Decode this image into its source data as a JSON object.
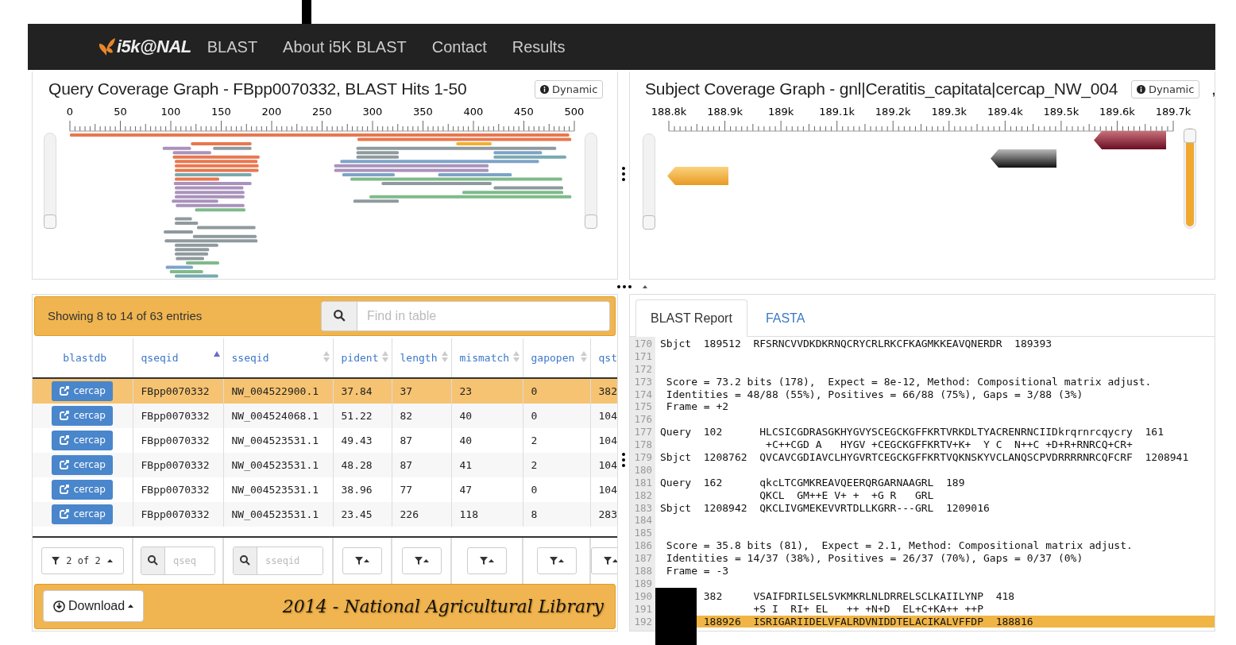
{
  "navbar": {
    "logo": "i5k@NAL",
    "links": [
      {
        "label": "BLAST"
      },
      {
        "label": "About i5K BLAST"
      },
      {
        "label": "Contact"
      },
      {
        "label": "Results"
      }
    ]
  },
  "query_graph": {
    "title": "Query Coverage Graph - FBpp0070332, BLAST Hits 1-50",
    "mode_button": "Dynamic",
    "axis_labels": [
      "0",
      "50",
      "100",
      "150",
      "200",
      "250",
      "300",
      "350",
      "400",
      "450",
      "500"
    ],
    "sliders": [
      {
        "level": 0
      },
      {
        "level": 0
      }
    ]
  },
  "subject_graph": {
    "title": "Subject Coverage Graph - gnl|Ceratitis_capitata|cercap_NW_004",
    "mode_button": "Dynamic",
    "title_tail": ",",
    "axis_labels": [
      "188.8k",
      "188.9k",
      "189k",
      "189.1k",
      "189.2k",
      "189.3k",
      "189.4k",
      "189.5k",
      "189.6k",
      "189.7k"
    ],
    "sliders": [
      {
        "level": 0
      },
      {
        "level": 1
      }
    ]
  },
  "table": {
    "info": "Showing 8 to 14 of 63 entries",
    "search": {
      "placeholder": "Find in table"
    },
    "columns": [
      {
        "label": "blastdb",
        "sortable": false,
        "sorted_ascending": false
      },
      {
        "label": "qseqid",
        "sortable": true,
        "sorted_ascending": true
      },
      {
        "label": "sseqid",
        "sortable": true,
        "sorted_ascending": false
      },
      {
        "label": "pident",
        "sortable": true,
        "sorted_ascending": false
      },
      {
        "label": "length",
        "sortable": true,
        "sorted_ascending": false
      },
      {
        "label": "mismatch",
        "sortable": true,
        "sorted_ascending": false
      },
      {
        "label": "gapopen",
        "sortable": true,
        "sorted_ascending": false
      },
      {
        "label": "qst",
        "sortable": false,
        "sorted_ascending": false
      }
    ],
    "rows": [
      {
        "selected": true,
        "cells": [
          "cercap",
          "FBpp0070332",
          "NW_004522900.1",
          "37.84",
          "37",
          "23",
          "0",
          "382"
        ]
      },
      {
        "selected": false,
        "cells": [
          "cercap",
          "FBpp0070332",
          "NW_004524068.1",
          "51.22",
          "82",
          "40",
          "0",
          "104"
        ]
      },
      {
        "selected": false,
        "cells": [
          "cercap",
          "FBpp0070332",
          "NW_004523531.1",
          "49.43",
          "87",
          "40",
          "2",
          "104"
        ]
      },
      {
        "selected": false,
        "cells": [
          "cercap",
          "FBpp0070332",
          "NW_004523531.1",
          "48.28",
          "87",
          "41",
          "2",
          "104"
        ]
      },
      {
        "selected": false,
        "cells": [
          "cercap",
          "FBpp0070332",
          "NW_004523531.1",
          "38.96",
          "77",
          "47",
          "0",
          "104"
        ]
      },
      {
        "selected": false,
        "cells": [
          "cercap",
          "FBpp0070332",
          "NW_004523531.1",
          "23.45",
          "226",
          "118",
          "8",
          "283"
        ]
      }
    ],
    "filters": [
      {
        "kind": "dropdown",
        "label": "2 of 2"
      },
      {
        "kind": "search",
        "placeholder": "qseq"
      },
      {
        "kind": "search",
        "placeholder": "sseqid"
      },
      {
        "kind": "filter"
      },
      {
        "kind": "filter"
      },
      {
        "kind": "filter"
      },
      {
        "kind": "filter"
      },
      {
        "kind": "filter"
      }
    ],
    "download": "Download",
    "credit": "2014 - National Agricultural Library"
  },
  "report": {
    "tabs": [
      {
        "label": "BLAST Report",
        "selected": true
      },
      {
        "label": "FASTA",
        "selected": false
      }
    ],
    "lines": [
      {
        "number": "170",
        "text": "Sbjct  189512  RFSRNCVVDKDKRNQCRYCRLRKCFKAGMKKEAVQNERDR  189393",
        "highlighted": false
      },
      {
        "number": "171",
        "highlighted": false
      },
      {
        "number": "172",
        "highlighted": false
      },
      {
        "number": "173",
        "text": " Score = 73.2 bits (178),  Expect = 8e-12, Method: Compositional matrix adjust.",
        "highlighted": false
      },
      {
        "number": "174",
        "text": " Identities = 48/88 (55%), Positives = 66/88 (75%), Gaps = 3/88 (3%)",
        "highlighted": false
      },
      {
        "number": "175",
        "text": " Frame = +2",
        "highlighted": false
      },
      {
        "number": "176",
        "highlighted": false
      },
      {
        "number": "177",
        "text": "Query  102      HLCSICGDRASGKHYGVYSCEGCKGFFKRTVRKDLTYACRENRNCIIDkrqrnrcqycry  161",
        "highlighted": false
      },
      {
        "number": "178",
        "text": "                 +C++CGD A   HYGV +CEGCKGFFKRTV+K+  Y C  N++C +D+R+RNRCQ+CR+",
        "highlighted": false
      },
      {
        "number": "179",
        "text": "Sbjct  1208762  QVCAVCGDIAVCLHYGVRTCEGCKGFFKRTVQKNSKYVCLANQSCPVDRRRRNRCQFCRF  1208941",
        "highlighted": false
      },
      {
        "number": "180",
        "highlighted": false
      },
      {
        "number": "181",
        "text": "Query  162      qkcLTCGMKREAVQEERQRGARNAAGRL  189",
        "highlighted": false
      },
      {
        "number": "182",
        "text": "                QKCL  GM++E V+ +  +G R   GRL",
        "highlighted": false
      },
      {
        "number": "183",
        "text": "Sbjct  1208942  QKCLIVGMEKEVVRTDLLKGRR---GRL  1209016",
        "highlighted": false
      },
      {
        "number": "184",
        "highlighted": false
      },
      {
        "number": "185",
        "highlighted": false
      },
      {
        "number": "186",
        "text": " Score = 35.8 bits (81),  Expect = 2.1, Method: Compositional matrix adjust.",
        "highlighted": false
      },
      {
        "number": "187",
        "text": " Identities = 14/37 (38%), Positives = 26/37 (70%), Gaps = 0/37 (0%)",
        "highlighted": false
      },
      {
        "number": "188",
        "text": " Frame = -3",
        "highlighted": false
      },
      {
        "number": "189",
        "highlighted": false
      },
      {
        "number": "190",
        "text": "       382     VSAIFDRILSELSVKMKRLNLDRRELSCLKAIILYNP  418",
        "highlighted": false
      },
      {
        "number": "191",
        "text": "               +S I  RI+ EL   ++ +N+D  EL+C+KA++ ++P",
        "highlighted": false
      },
      {
        "number": "192",
        "text": "       188926  ISRIGARIIDELVFALRDVNIDDTELACIKALVFFDP  188816",
        "highlighted": true
      }
    ]
  }
}
